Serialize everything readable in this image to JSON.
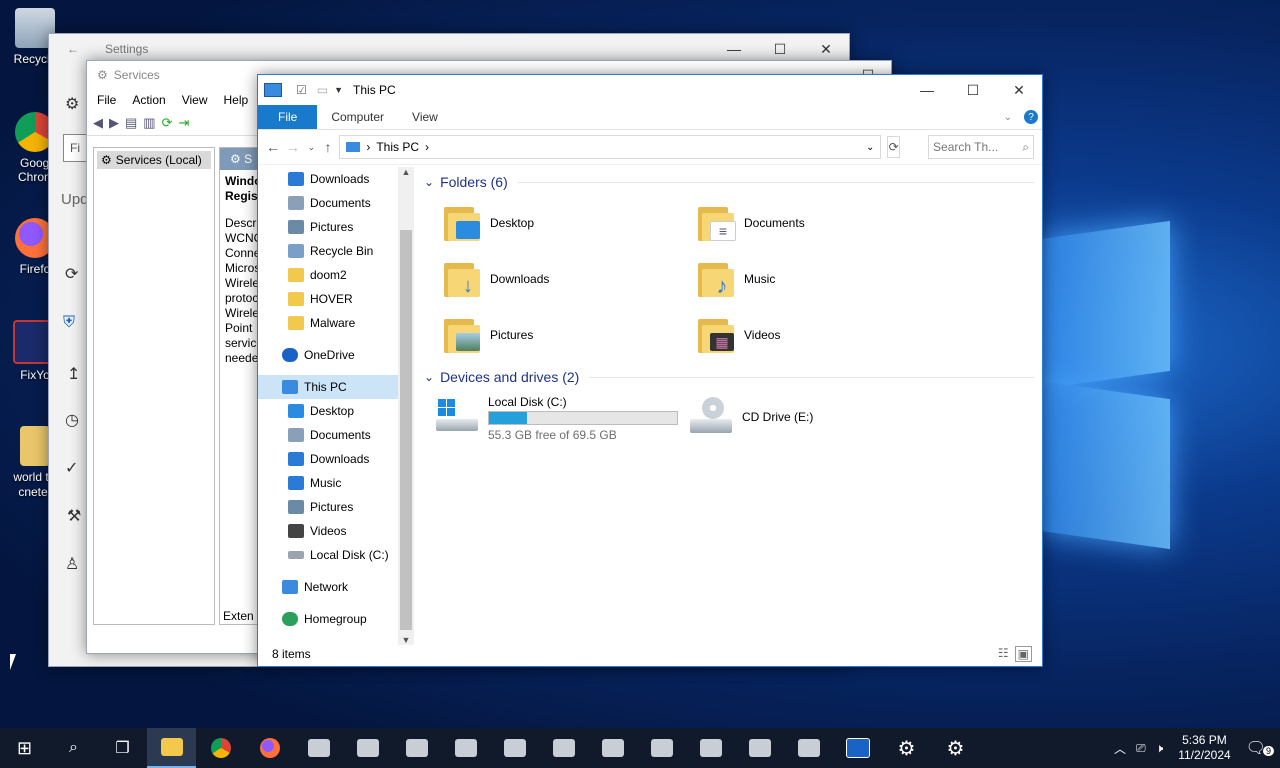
{
  "desktop": {
    "icons": [
      {
        "label": "Recycle",
        "icon": "recycle-bin-icon"
      },
      {
        "label": "Googl Chrom",
        "icon": "chrome-icon"
      },
      {
        "label": "Firefo",
        "icon": "firefox-icon"
      },
      {
        "label": "FixYo",
        "icon": "fixyo-icon"
      },
      {
        "label": "world tr cnete",
        "icon": "folder-icon"
      }
    ]
  },
  "settings_window": {
    "title": "Settings",
    "search_placeholder": "Fi",
    "update_label": "Upd"
  },
  "services_window": {
    "title": "Services",
    "menu": [
      "File",
      "Action",
      "View",
      "Help"
    ],
    "tree_item": "Services (Local)",
    "detail_header": "S",
    "detail_title_lines": [
      "Windo",
      "Regist"
    ],
    "detail_desc_lines": [
      "Descri",
      "WCNC",
      "Conne",
      "Micros",
      "Wirele",
      "protoc",
      "Wirele",
      "Point",
      "service",
      "neede"
    ],
    "extended_tab": "Exten"
  },
  "explorer": {
    "title": "This PC",
    "ribbon_tabs": [
      "File",
      "Computer",
      "View"
    ],
    "address_path": "This PC",
    "search_placeholder": "Search Th...",
    "nav_quick": [
      {
        "label": "Downloads",
        "pinned": true,
        "icon": "downloads-icon",
        "color": "#2a7bd6"
      },
      {
        "label": "Documents",
        "pinned": true,
        "icon": "documents-icon",
        "color": "#8aa0b8"
      },
      {
        "label": "Pictures",
        "pinned": true,
        "icon": "pictures-icon",
        "color": "#6a8aa8"
      },
      {
        "label": "Recycle Bin",
        "pinned": true,
        "icon": "recycle-bin-icon",
        "color": "#7aa0c8"
      },
      {
        "label": "doom2",
        "pinned": false,
        "icon": "folder-icon",
        "color": "#f2c94c"
      },
      {
        "label": "HOVER",
        "pinned": false,
        "icon": "folder-icon",
        "color": "#f2c94c"
      },
      {
        "label": "Malware",
        "pinned": false,
        "icon": "folder-icon",
        "color": "#f2c94c"
      }
    ],
    "nav_onedrive": "OneDrive",
    "nav_thispc": "This PC",
    "nav_thispc_children": [
      {
        "label": "Desktop",
        "icon": "desktop-icon",
        "color": "#2a8be0"
      },
      {
        "label": "Documents",
        "icon": "documents-icon",
        "color": "#8aa0b8"
      },
      {
        "label": "Downloads",
        "icon": "downloads-icon",
        "color": "#2a7bd6"
      },
      {
        "label": "Music",
        "icon": "music-icon",
        "color": "#2a7bd6"
      },
      {
        "label": "Pictures",
        "icon": "pictures-icon",
        "color": "#6a8aa8"
      },
      {
        "label": "Videos",
        "icon": "videos-icon",
        "color": "#444444"
      },
      {
        "label": "Local Disk (C:)",
        "icon": "drive-icon",
        "color": "#9aa5b0"
      }
    ],
    "nav_network": "Network",
    "nav_homegroup": "Homegroup",
    "folders_header": "Folders (6)",
    "folders": [
      {
        "label": "Desktop",
        "icon": "desktop-folder-icon",
        "overlay_color": "#2a8be0",
        "overlay_glyph": ""
      },
      {
        "label": "Documents",
        "icon": "documents-folder-icon",
        "overlay_color": "#ffffff",
        "overlay_glyph": "≡"
      },
      {
        "label": "Downloads",
        "icon": "downloads-folder-icon",
        "overlay_color": "transparent",
        "overlay_glyph": "↓"
      },
      {
        "label": "Music",
        "icon": "music-folder-icon",
        "overlay_color": "transparent",
        "overlay_glyph": "♪"
      },
      {
        "label": "Pictures",
        "icon": "pictures-folder-icon",
        "overlay_color": "#7aa6c8",
        "overlay_glyph": ""
      },
      {
        "label": "Videos",
        "icon": "videos-folder-icon",
        "overlay_color": "#333333",
        "overlay_glyph": "▦"
      }
    ],
    "drives_header": "Devices and drives (2)",
    "drives": [
      {
        "label": "Local Disk (C:)",
        "free_text": "55.3 GB free of 69.5 GB",
        "used_fraction": 0.2
      },
      {
        "label": "CD Drive (E:)"
      }
    ],
    "status": "8 items"
  },
  "taskbar": {
    "clock_time": "5:36 PM",
    "clock_date": "11/2/2024",
    "notification_count": "9",
    "accent": "#7ab4f0"
  }
}
